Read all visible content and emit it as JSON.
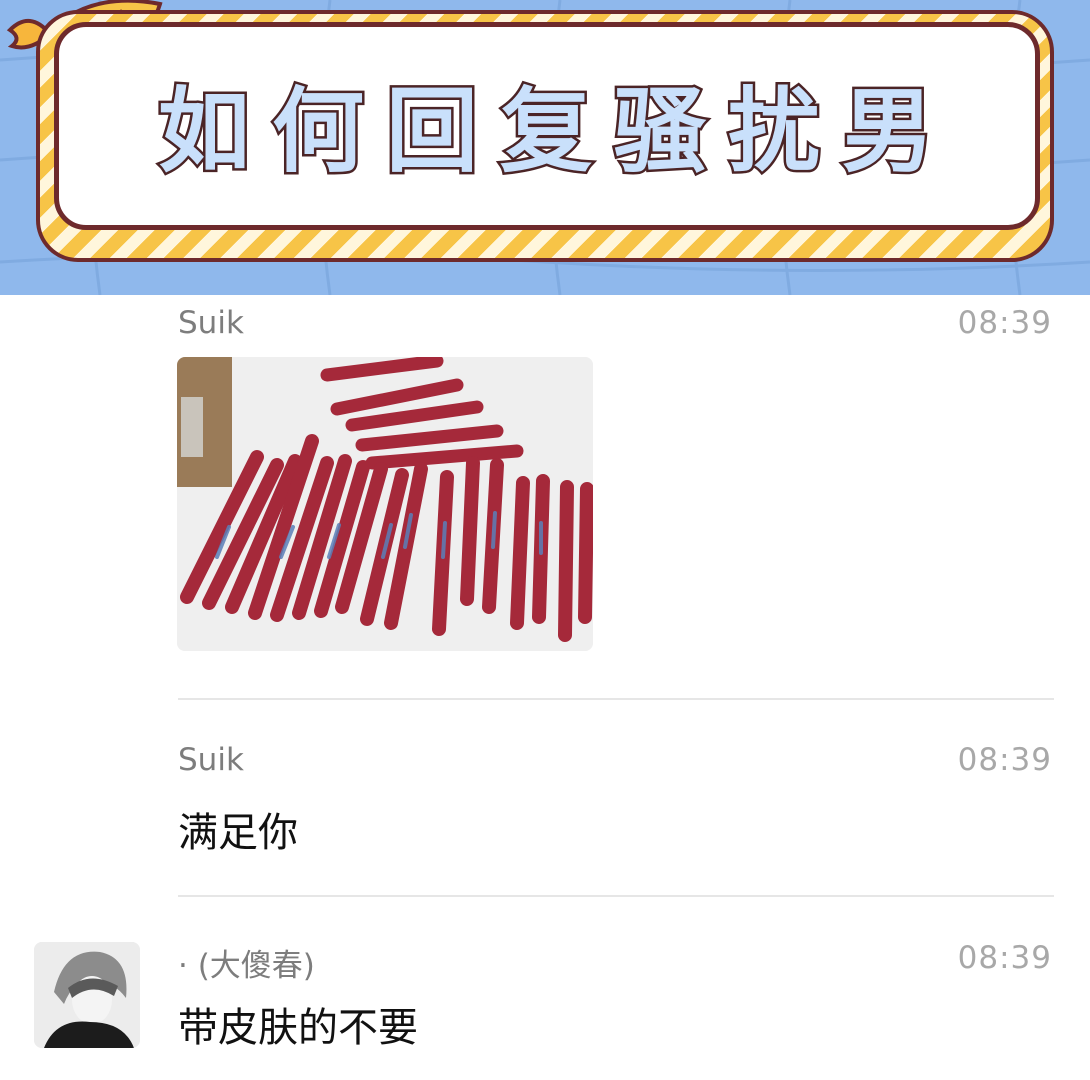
{
  "banner": {
    "title": "如何回复骚扰男"
  },
  "messages": [
    {
      "sender": "Suik",
      "time": "08:39",
      "type": "image",
      "image_icon": "photo-of-sausages"
    },
    {
      "sender": "Suik",
      "time": "08:39",
      "type": "text",
      "text": "满足你"
    },
    {
      "sender": "· (大傻春)",
      "time": "08:39",
      "type": "text",
      "text": "带皮肤的不要",
      "avatar_icon": "user-avatar"
    }
  ],
  "colors": {
    "banner_bg": "#8fb8ec",
    "title_fill": "#c9e0fb",
    "title_outline": "#4b2426",
    "stripe_yellow": "#f7c447",
    "sender_gray": "#7d7d7d",
    "time_gray": "#a8a8a8"
  }
}
